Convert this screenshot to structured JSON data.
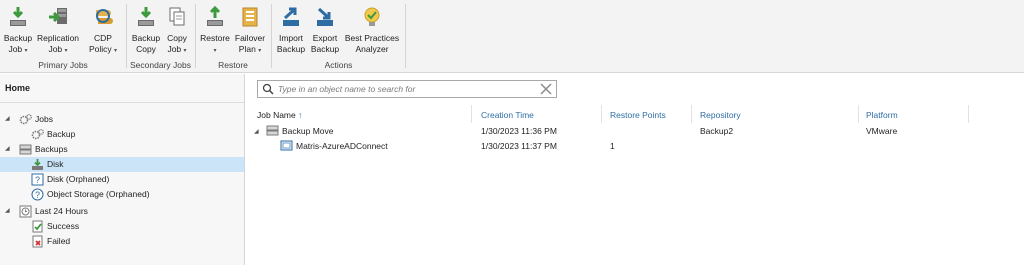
{
  "ribbon": {
    "groups": [
      {
        "label": "Primary Jobs",
        "buttons": [
          {
            "line1": "Backup",
            "line2": "Job",
            "has_menu": true,
            "icon": "backup-job-icon"
          },
          {
            "line1": "Replication",
            "line2": "Job",
            "has_menu": true,
            "icon": "replication-job-icon"
          },
          {
            "line1": "CDP",
            "line2": "Policy",
            "has_menu": true,
            "icon": "cdp-policy-icon"
          }
        ]
      },
      {
        "label": "Secondary Jobs",
        "buttons": [
          {
            "line1": "Backup",
            "line2": "Copy",
            "has_menu": false,
            "icon": "backup-copy-icon"
          },
          {
            "line1": "Copy",
            "line2": "Job",
            "has_menu": true,
            "icon": "copy-job-icon"
          }
        ]
      },
      {
        "label": "Restore",
        "buttons": [
          {
            "line1": "Restore",
            "line2": "",
            "has_menu": true,
            "icon": "restore-icon"
          },
          {
            "line1": "Failover",
            "line2": "Plan",
            "has_menu": true,
            "icon": "failover-plan-icon"
          }
        ]
      },
      {
        "label": "Actions",
        "buttons": [
          {
            "line1": "Import",
            "line2": "Backup",
            "has_menu": false,
            "icon": "import-backup-icon"
          },
          {
            "line1": "Export",
            "line2": "Backup",
            "has_menu": false,
            "icon": "export-backup-icon"
          },
          {
            "line1": "Best Practices",
            "line2": "Analyzer",
            "has_menu": false,
            "icon": "best-practices-analyzer-icon"
          }
        ]
      }
    ],
    "menu_caret": "▾"
  },
  "nav": {
    "title": "Home",
    "items": [
      {
        "label": "Jobs",
        "level": 0,
        "expanded": true,
        "icon": "jobs-gear-icon"
      },
      {
        "label": "Backup",
        "level": 1,
        "icon": "backup-gear-icon"
      },
      {
        "label": "Backups",
        "level": 0,
        "expanded": true,
        "icon": "backups-icon"
      },
      {
        "label": "Disk",
        "level": 1,
        "selected": true,
        "icon": "disk-icon"
      },
      {
        "label": "Disk (Orphaned)",
        "level": 1,
        "icon": "disk-orphaned-icon"
      },
      {
        "label": "Object Storage (Orphaned)",
        "level": 1,
        "icon": "object-storage-orphaned-icon"
      },
      {
        "label": "Last 24 Hours",
        "level": 0,
        "expanded": true,
        "icon": "last-24-hours-icon"
      },
      {
        "label": "Success",
        "level": 1,
        "icon": "success-icon"
      },
      {
        "label": "Failed",
        "level": 1,
        "icon": "failed-icon"
      }
    ],
    "expand_glyph": "◢"
  },
  "search": {
    "placeholder": "Type in an object name to search for"
  },
  "table": {
    "columns": [
      "Job Name",
      "Creation Time",
      "Restore Points",
      "Repository",
      "Platform"
    ],
    "sort_glyph": "↑",
    "rows": [
      {
        "name": "Backup Move",
        "creation_time": "1/30/2023 11:36 PM",
        "restore_points": "",
        "repository": "Backup2",
        "platform": "VMware",
        "level": 0
      },
      {
        "name": "Matris-AzureADConnect",
        "creation_time": "1/30/2023 11:37 PM",
        "restore_points": "1",
        "repository": "",
        "platform": "",
        "level": 1
      }
    ]
  },
  "colors": {
    "accent": "#2e6da4",
    "green": "#3c9a3c",
    "selection": "#cce4f7"
  }
}
